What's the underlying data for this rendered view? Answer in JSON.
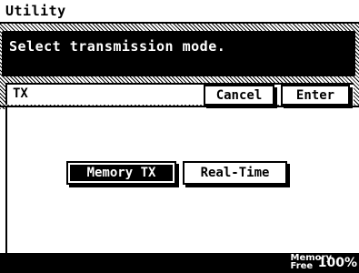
{
  "title": "Utility",
  "message": "Select transmission mode.",
  "panel": {
    "label": "TX",
    "cancel_label": "Cancel",
    "enter_label": "Enter"
  },
  "options": [
    {
      "label": "Memory TX",
      "selected": true
    },
    {
      "label": "Real-Time",
      "selected": false
    }
  ],
  "status": {
    "memory_line1": "Memory",
    "memory_line2": "Free",
    "memory_percent": "100%"
  }
}
